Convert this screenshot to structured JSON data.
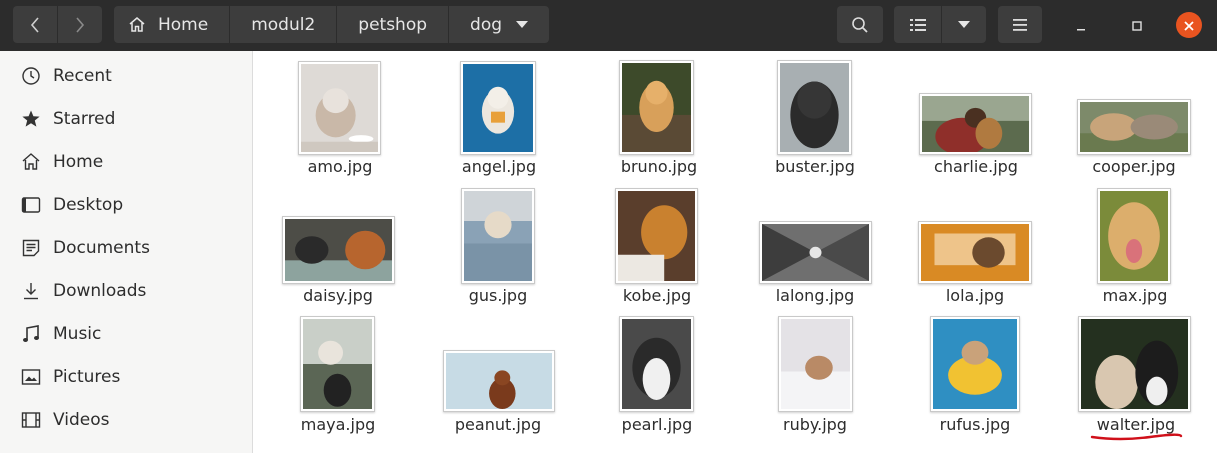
{
  "header": {
    "breadcrumbs": [
      "Home",
      "modul2",
      "petshop",
      "dog"
    ]
  },
  "icons": {
    "back": "chevron-left-icon",
    "forward": "chevron-right-icon",
    "home": "home-icon",
    "dropdown": "caret-down-icon",
    "search": "search-icon",
    "list_view": "list-view-icon",
    "menu": "hamburger-menu-icon",
    "minimize": "minimize-icon",
    "maximize": "maximize-icon",
    "close": "close-icon"
  },
  "sidebar": {
    "items": [
      {
        "label": "Recent",
        "icon": "clock-icon"
      },
      {
        "label": "Starred",
        "icon": "star-icon"
      },
      {
        "label": "Home",
        "icon": "home-icon"
      },
      {
        "label": "Desktop",
        "icon": "desktop-icon"
      },
      {
        "label": "Documents",
        "icon": "document-icon"
      },
      {
        "label": "Downloads",
        "icon": "download-icon"
      },
      {
        "label": "Music",
        "icon": "music-icon"
      },
      {
        "label": "Pictures",
        "icon": "picture-icon"
      },
      {
        "label": "Videos",
        "icon": "video-icon"
      }
    ]
  },
  "files": [
    "amo.jpg",
    "angel.jpg",
    "bruno.jpg",
    "buster.jpg",
    "charlie.jpg",
    "cooper.jpg",
    "daisy.jpg",
    "gus.jpg",
    "kobe.jpg",
    "lalong.jpg",
    "lola.jpg",
    "max.jpg",
    "maya.jpg",
    "peanut.jpg",
    "pearl.jpg",
    "ruby.jpg",
    "rufus.jpg",
    "walter.jpg"
  ],
  "colors": {
    "header_bg": "#2c2c2c",
    "button_bg": "#3d3d3d",
    "close_button": "#e95420",
    "sidebar_bg": "#f6f6f5",
    "annotation_underline": "#d0101a"
  }
}
